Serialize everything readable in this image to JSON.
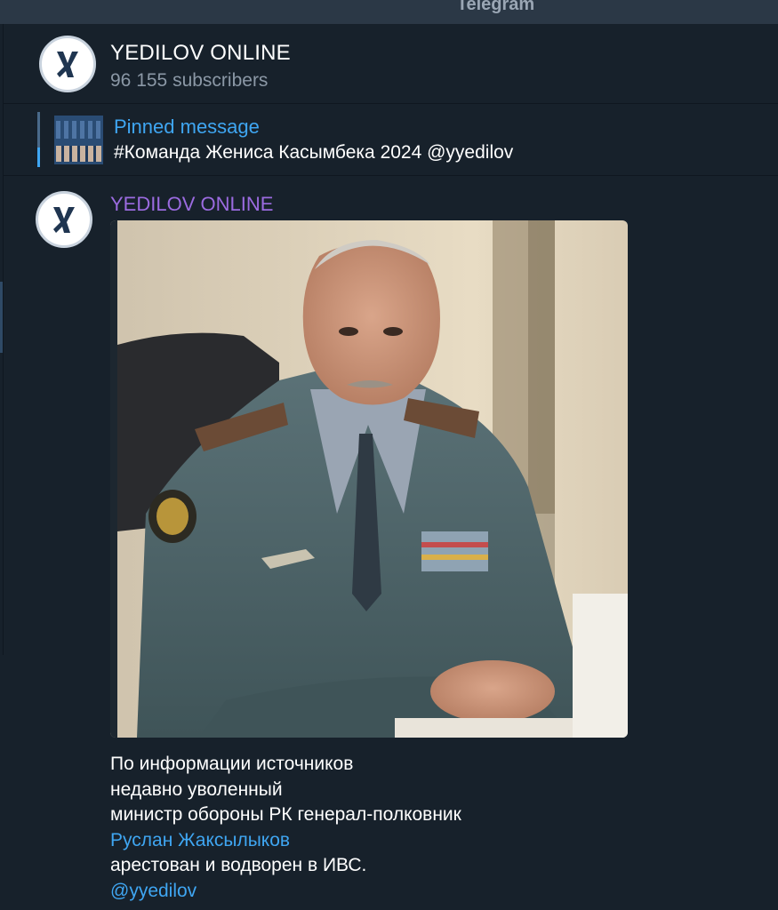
{
  "window": {
    "app_title": "Telegram"
  },
  "channel": {
    "name": "YEDILOV ONLINE",
    "subscribers": "96 155 subscribers",
    "avatar_icon": "yedilov-logo-icon"
  },
  "pinned": {
    "title": "Pinned message",
    "text": "#Команда Жениса Касымбека 2024 @yyedilov"
  },
  "post": {
    "author": "YEDILOV ONLINE",
    "lines": [
      "По информации источников",
      "недавно уволенный",
      "министр обороны РК генерал-полковник"
    ],
    "name_link": "Руслан Жаксылыков",
    "line_after": "арестован и водворен в ИВС.",
    "mention": "@yyedilov"
  },
  "colors": {
    "background": "#17212b",
    "accent_link": "#3fa6f2",
    "author_name": "#9b6be0",
    "secondary_text": "#8b98a6"
  }
}
